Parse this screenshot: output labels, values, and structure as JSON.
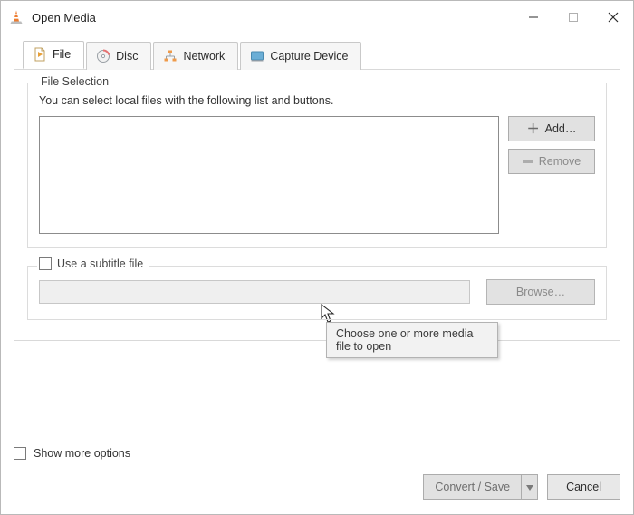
{
  "window": {
    "title": "Open Media"
  },
  "tabs": {
    "file": "File",
    "disc": "Disc",
    "network": "Network",
    "capture": "Capture Device"
  },
  "file_selection": {
    "legend": "File Selection",
    "help": "You can select local files with the following list and buttons.",
    "add_label": "Add…",
    "remove_label": "Remove",
    "tooltip": "Choose one or more media file to open"
  },
  "subtitle": {
    "label": "Use a subtitle file",
    "browse_label": "Browse…"
  },
  "bottom": {
    "more_label": "Show more options",
    "convert_label": "Convert / Save",
    "cancel_label": "Cancel"
  }
}
